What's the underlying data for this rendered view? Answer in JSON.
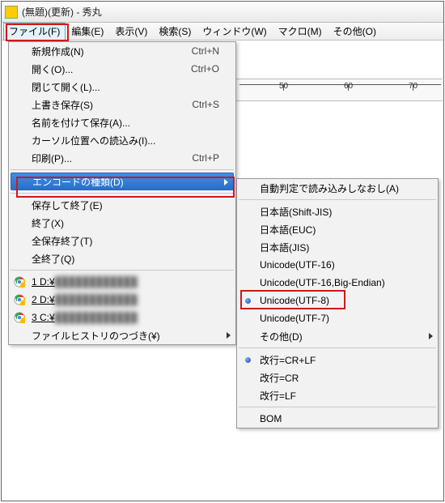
{
  "title": "(無題)(更新) - 秀丸",
  "menubar": {
    "file": "ファイル(F)",
    "edit": "編集(E)",
    "view": "表示(V)",
    "search": "検索(S)",
    "window": "ウィンドウ(W)",
    "macro": "マクロ(M)",
    "other": "その他(O)"
  },
  "ruler": {
    "t50": "50",
    "t60": "60",
    "t70": "70"
  },
  "fileMenu": {
    "new": {
      "label": "新規作成(N)",
      "accel": "Ctrl+N"
    },
    "open": {
      "label": "開く(O)...",
      "accel": "Ctrl+O"
    },
    "closeOpen": {
      "label": "閉じて開く(L)...",
      "accel": ""
    },
    "save": {
      "label": "上書き保存(S)",
      "accel": "Ctrl+S"
    },
    "saveAs": {
      "label": "名前を付けて保存(A)...",
      "accel": ""
    },
    "loadCursor": {
      "label": "カーソル位置への読込み(I)...",
      "accel": ""
    },
    "print": {
      "label": "印刷(P)...",
      "accel": "Ctrl+P"
    },
    "encoding": {
      "label": "エンコードの種類(D)",
      "accel": ""
    },
    "saveExit": {
      "label": "保存して終了(E)",
      "accel": ""
    },
    "exit": {
      "label": "終了(X)",
      "accel": ""
    },
    "saveAllExit": {
      "label": "全保存終了(T)",
      "accel": ""
    },
    "exitAll": {
      "label": "全終了(Q)",
      "accel": ""
    },
    "recent1": {
      "label": "1 D:¥"
    },
    "recent1b": {
      "label": "████████████"
    },
    "recent2": {
      "label": "2 D:¥"
    },
    "recent2b": {
      "label": "████████████"
    },
    "recent3": {
      "label": "3 C:¥"
    },
    "recent3b": {
      "label": "████████████"
    },
    "history": {
      "label": "ファイルヒストリのつづき(¥)",
      "accel": ""
    }
  },
  "encMenu": {
    "auto": "自動判定で読み込みしなおし(A)",
    "sjis": "日本語(Shift-JIS)",
    "euc": "日本語(EUC)",
    "jis": "日本語(JIS)",
    "utf16": "Unicode(UTF-16)",
    "utf16be": "Unicode(UTF-16,Big-Endian)",
    "utf8": "Unicode(UTF-8)",
    "utf7": "Unicode(UTF-7)",
    "other": "その他(D)",
    "crlf": "改行=CR+LF",
    "cr": "改行=CR",
    "lf": "改行=LF",
    "bom": "BOM"
  }
}
